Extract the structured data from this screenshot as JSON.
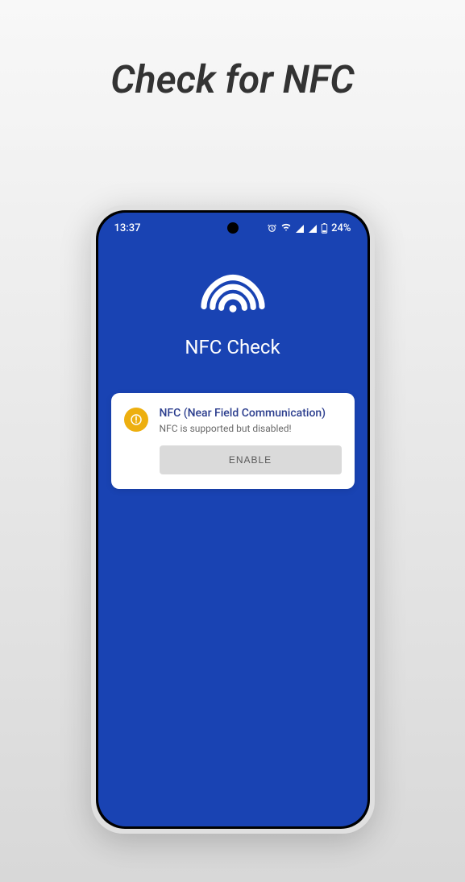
{
  "promo": {
    "title": "Check for NFC"
  },
  "statusbar": {
    "time": "13:37",
    "battery": "24%"
  },
  "app": {
    "title": "NFC Check"
  },
  "card": {
    "title": "NFC (Near Field Communication)",
    "subtitle": "NFC is supported but disabled!",
    "button_label": "ENABLE"
  }
}
